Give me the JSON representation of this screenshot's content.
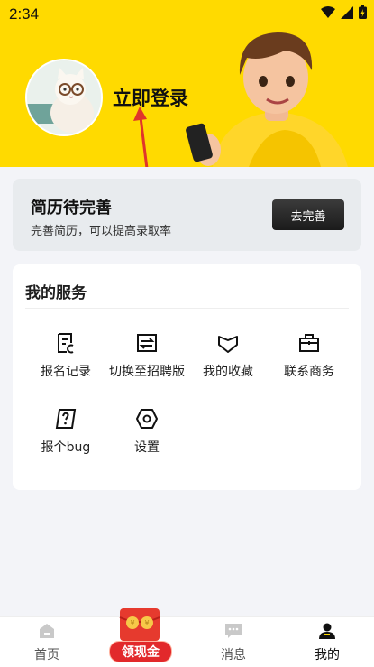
{
  "status": {
    "time": "2:34"
  },
  "profile": {
    "login_label": "立即登录"
  },
  "resume": {
    "title": "简历待完善",
    "subtitle": "完善简历，可以提高录取率",
    "button": "去完善"
  },
  "services": {
    "title": "我的服务",
    "items": [
      {
        "label": "报名记录",
        "icon": "document-edit-icon"
      },
      {
        "label": "切换至招聘版",
        "icon": "switch-icon"
      },
      {
        "label": "我的收藏",
        "icon": "heart-icon"
      },
      {
        "label": "联系商务",
        "icon": "briefcase-icon"
      },
      {
        "label": "报个bug",
        "icon": "question-icon"
      },
      {
        "label": "设置",
        "icon": "hexagon-settings-icon"
      }
    ]
  },
  "nav": {
    "home": "首页",
    "cash": "领现金",
    "messages": "消息",
    "mine": "我的"
  },
  "colors": {
    "accent": "#ffda00",
    "cash_red": "#e2292b"
  }
}
